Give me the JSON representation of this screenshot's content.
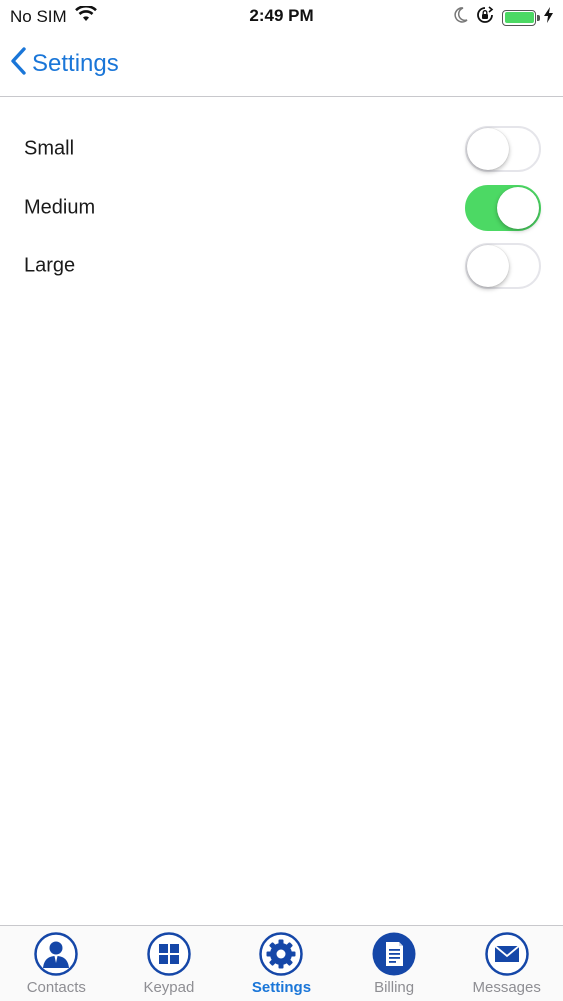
{
  "status_bar": {
    "carrier": "No SIM",
    "time": "2:49 PM",
    "icons": [
      "wifi-icon",
      "moon-icon",
      "orientation-lock-icon",
      "battery-icon",
      "charging-bolt-icon"
    ],
    "battery_color": "#4cd964"
  },
  "nav": {
    "back_label": "Settings",
    "accent_color": "#1a76d8"
  },
  "options": [
    {
      "label": "Small",
      "on": false
    },
    {
      "label": "Medium",
      "on": true
    },
    {
      "label": "Large",
      "on": false
    }
  ],
  "tabs": [
    {
      "label": "Contacts",
      "icon": "contacts-icon",
      "active": false
    },
    {
      "label": "Keypad",
      "icon": "keypad-icon",
      "active": false
    },
    {
      "label": "Settings",
      "icon": "gear-icon",
      "active": true
    },
    {
      "label": "Billing",
      "icon": "billing-icon",
      "active": false
    },
    {
      "label": "Messages",
      "icon": "envelope-icon",
      "active": false
    }
  ],
  "colors": {
    "toggle_on": "#4cd964",
    "tab_icon_blue": "#1547a8"
  }
}
